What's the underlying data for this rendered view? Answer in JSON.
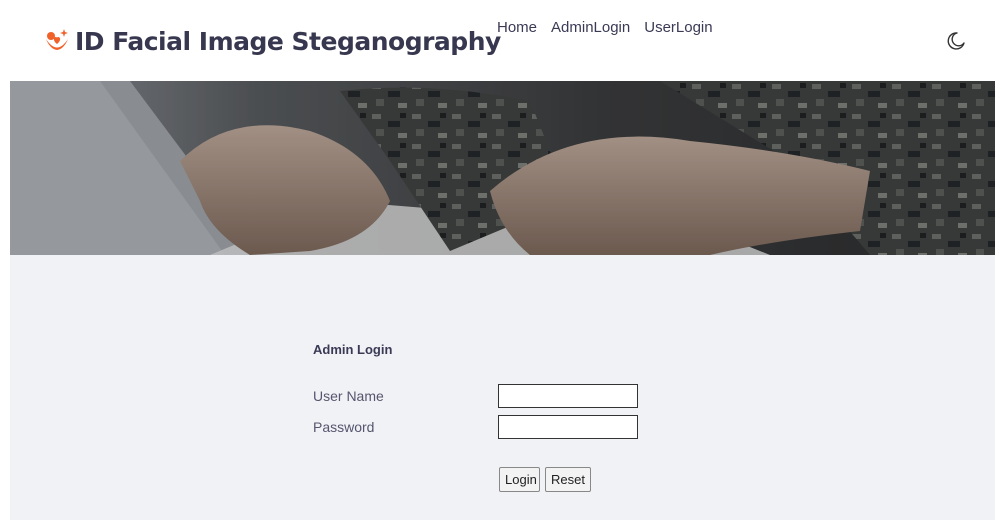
{
  "header": {
    "brand": "ID Facial Image Steganography",
    "brand_icon": "person-heart-icon",
    "brand_color": "#f0622a",
    "nav": [
      {
        "label": "Home"
      },
      {
        "label": "AdminLogin"
      },
      {
        "label": "UserLogin"
      }
    ],
    "theme_toggle_icon": "moon-icon"
  },
  "hero": {
    "image": "hands-typing-on-laptop-camouflage-sleeves"
  },
  "login_form": {
    "title": "Admin Login",
    "username_label": "User Name",
    "username_value": "",
    "password_label": "Password",
    "password_value": "",
    "login_button": "Login",
    "reset_button": "Reset"
  },
  "colors": {
    "text_dark": "#37374f",
    "content_bg": "#f1f2f6"
  }
}
